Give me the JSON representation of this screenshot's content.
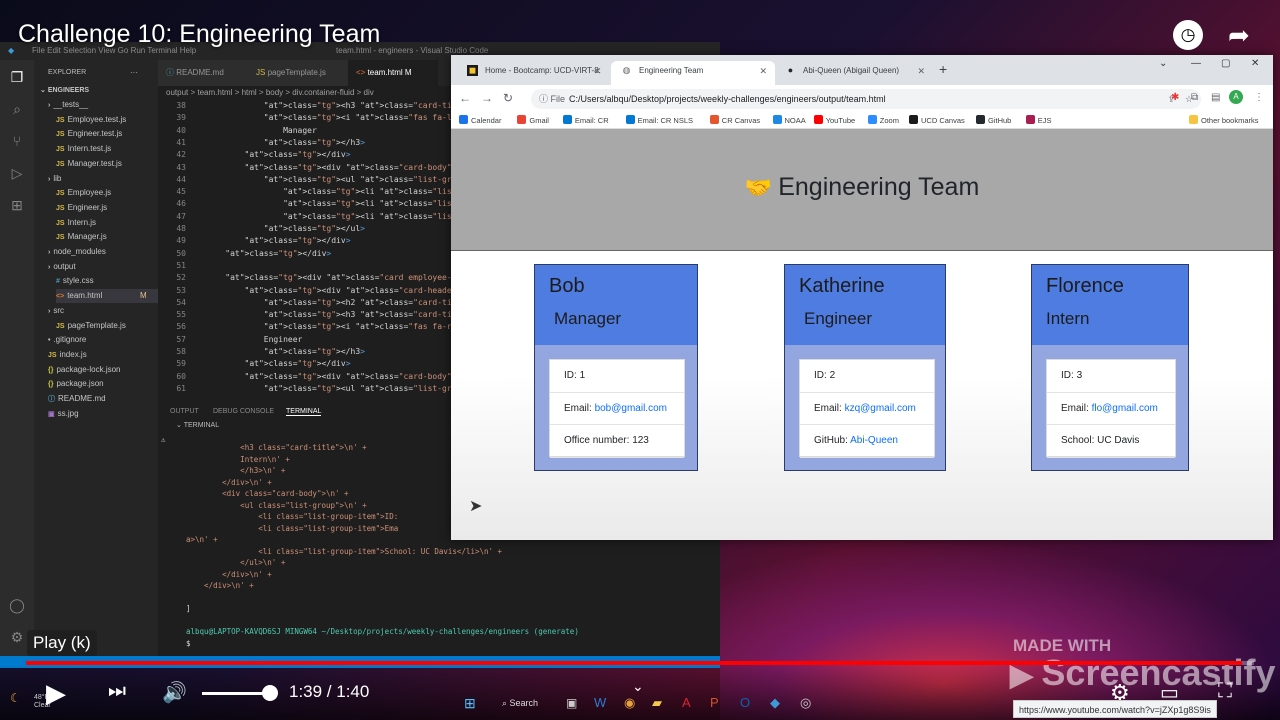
{
  "video": {
    "title": "Challenge 10: Engineering Team",
    "tooltip": "Play (k)",
    "time": "1:39 / 1:40",
    "progress": 0.99,
    "volume": 0.88,
    "watermark_top": "MADE WITH",
    "watermark_brand": "Screencastify",
    "url_hint": "https://www.youtube.com/watch?v=jZXp1g8S9is"
  },
  "vscode": {
    "title": "team.html - engineers - Visual Studio Code",
    "menu": [
      "File",
      "Edit",
      "Selection",
      "View",
      "Go",
      "Run",
      "Terminal",
      "Help"
    ],
    "explorer_label": "EXPLORER",
    "root": "ENGINEERS",
    "tree": [
      {
        "label": "__tests__",
        "kind": "folder",
        "indent": 1
      },
      {
        "label": "Employee.test.js",
        "kind": "js",
        "indent": 2
      },
      {
        "label": "Engineer.test.js",
        "kind": "js",
        "indent": 2
      },
      {
        "label": "Intern.test.js",
        "kind": "js",
        "indent": 2
      },
      {
        "label": "Manager.test.js",
        "kind": "js",
        "indent": 2
      },
      {
        "label": "lib",
        "kind": "folder",
        "indent": 1
      },
      {
        "label": "Employee.js",
        "kind": "js",
        "indent": 2
      },
      {
        "label": "Engineer.js",
        "kind": "js",
        "indent": 2
      },
      {
        "label": "Intern.js",
        "kind": "js",
        "indent": 2
      },
      {
        "label": "Manager.js",
        "kind": "js",
        "indent": 2
      },
      {
        "label": "node_modules",
        "kind": "folder",
        "indent": 1
      },
      {
        "label": "output",
        "kind": "folder",
        "indent": 1
      },
      {
        "label": "style.css",
        "kind": "css",
        "indent": 2
      },
      {
        "label": "team.html",
        "kind": "html",
        "indent": 2,
        "badge": "M"
      },
      {
        "label": "src",
        "kind": "folder",
        "indent": 1
      },
      {
        "label": "pageTemplate.js",
        "kind": "js",
        "indent": 2
      },
      {
        "label": ".gitignore",
        "kind": "file",
        "indent": 1
      },
      {
        "label": "index.js",
        "kind": "js",
        "indent": 1
      },
      {
        "label": "package-lock.json",
        "kind": "json",
        "indent": 1
      },
      {
        "label": "package.json",
        "kind": "json",
        "indent": 1
      },
      {
        "label": "README.md",
        "kind": "md",
        "indent": 1
      },
      {
        "label": "ss.jpg",
        "kind": "img",
        "indent": 1
      }
    ],
    "tabs": [
      "README.md",
      "pageTemplate.js",
      "team.html M"
    ],
    "breadcrumb": "output > team.html > html > body > div.container-fluid > div",
    "code": [
      {
        "n": "38",
        "t": "            <h3 class=\"card-title\">"
      },
      {
        "n": "39",
        "t": "            <i class=\"fas fa-light fa-arrows"
      },
      {
        "n": "40",
        "t": "                Manager"
      },
      {
        "n": "41",
        "t": "            </h3>"
      },
      {
        "n": "42",
        "t": "        </div>"
      },
      {
        "n": "43",
        "t": "        <div class=\"card-body\">"
      },
      {
        "n": "44",
        "t": "            <ul class=\"list-group\">"
      },
      {
        "n": "45",
        "t": "                <li class=\"list-group-item\""
      },
      {
        "n": "46",
        "t": "                <li class=\"list-group-item\""
      },
      {
        "n": "47",
        "t": "                <li class=\"list-group-item\""
      },
      {
        "n": "48",
        "t": "            </ul>"
      },
      {
        "n": "49",
        "t": "        </div>"
      },
      {
        "n": "50",
        "t": "    </div>"
      },
      {
        "n": "51",
        "t": ""
      },
      {
        "n": "52",
        "t": "    <div class=\"card employee-card\">"
      },
      {
        "n": "53",
        "t": "        <div class=\"card-header\">"
      },
      {
        "n": "54",
        "t": "            <h2 class=\"card-title\">Katherine"
      },
      {
        "n": "55",
        "t": "            <h3 class=\"card-title\">"
      },
      {
        "n": "56",
        "t": "            <i class=\"fas fa-regular fa-gear"
      },
      {
        "n": "57",
        "t": "            Engineer"
      },
      {
        "n": "58",
        "t": "            </h3>"
      },
      {
        "n": "59",
        "t": "        </div>"
      },
      {
        "n": "60",
        "t": "        <div class=\"card-body\">"
      },
      {
        "n": "61",
        "t": "            <ul class=\"list-group\">"
      }
    ],
    "panel_tabs": [
      "OUTPUT",
      "DEBUG CONSOLE",
      "TERMINAL"
    ],
    "terminal_header": "TERMINAL",
    "terminal": [
      "            <h3 class=\"card-title\">\\n' +",
      "            Intern\\n' +",
      "            </h3>\\n' +",
      "        </div>\\n' +",
      "        <div class=\"card-body\">\\n' +",
      "            <ul class=\"list-group\">\\n' +",
      "                <li class=\"list-group-item\">ID:",
      "                <li class=\"list-group-item\">Ema",
      "a>\\n' +",
      "                <li class=\"list-group-item\">School: UC Davis</li>\\n' +",
      "            </ul>\\n' +",
      "        </div>\\n' +",
      "    </div>\\n' +",
      "",
      "]",
      "",
      "albqu@LAPTOP-KAVQD6SJ MINGW64 ~/Desktop/projects/weekly-challenges/engineers (generate)",
      "$ "
    ]
  },
  "chrome": {
    "tabs": [
      {
        "label": "Home - Bootcamp: UCD-VIRT-8:",
        "active": false
      },
      {
        "label": "Engineering Team",
        "active": true
      },
      {
        "label": "Abi-Queen (Abigail Queen)",
        "active": false
      }
    ],
    "url_prefix": "File",
    "url": "C:/Users/albqu/Desktop/projects/weekly-challenges/engineers/output/team.html",
    "bookmarks": [
      {
        "label": "Calendar",
        "color": "#1a73e8"
      },
      {
        "label": "Gmail",
        "color": "#ea4335"
      },
      {
        "label": "Email: CR",
        "color": "#0078d4"
      },
      {
        "label": "Email: CR NSLS",
        "color": "#0078d4"
      },
      {
        "label": "CR Canvas",
        "color": "#e4572e"
      },
      {
        "label": "NOAA",
        "color": "#1e88e5"
      },
      {
        "label": "YouTube",
        "color": "#ff0000"
      },
      {
        "label": "Zoom",
        "color": "#2d8cff"
      },
      {
        "label": "UCD Canvas",
        "color": "#1b1b1b"
      },
      {
        "label": "GitHub",
        "color": "#24292f"
      },
      {
        "label": "EJS",
        "color": "#a91e50"
      }
    ],
    "other_bookmarks": "Other bookmarks",
    "profile_initial": "A"
  },
  "page": {
    "title": "Engineering Team",
    "cards": [
      {
        "name": "Bob",
        "role": "Manager",
        "items": [
          {
            "label": "ID: ",
            "value": "1",
            "link": false
          },
          {
            "label": "Email: ",
            "value": "bob@gmail.com",
            "link": true
          },
          {
            "label": "Office number: ",
            "value": "123",
            "link": false
          }
        ]
      },
      {
        "name": "Katherine",
        "role": "Engineer",
        "items": [
          {
            "label": "ID: ",
            "value": "2",
            "link": false
          },
          {
            "label": "Email: ",
            "value": "kzq@gmail.com",
            "link": true
          },
          {
            "label": "GitHub: ",
            "value": "Abi-Queen",
            "link": true
          }
        ]
      },
      {
        "name": "Florence",
        "role": "Intern",
        "items": [
          {
            "label": "ID: ",
            "value": "3",
            "link": false
          },
          {
            "label": "Email: ",
            "value": "flo@gmail.com",
            "link": true
          },
          {
            "label": "School: ",
            "value": "UC Davis",
            "link": false
          }
        ]
      }
    ]
  },
  "weather": {
    "temp": "48°F",
    "desc": "Clear"
  },
  "taskbar": {
    "search": "Search"
  }
}
